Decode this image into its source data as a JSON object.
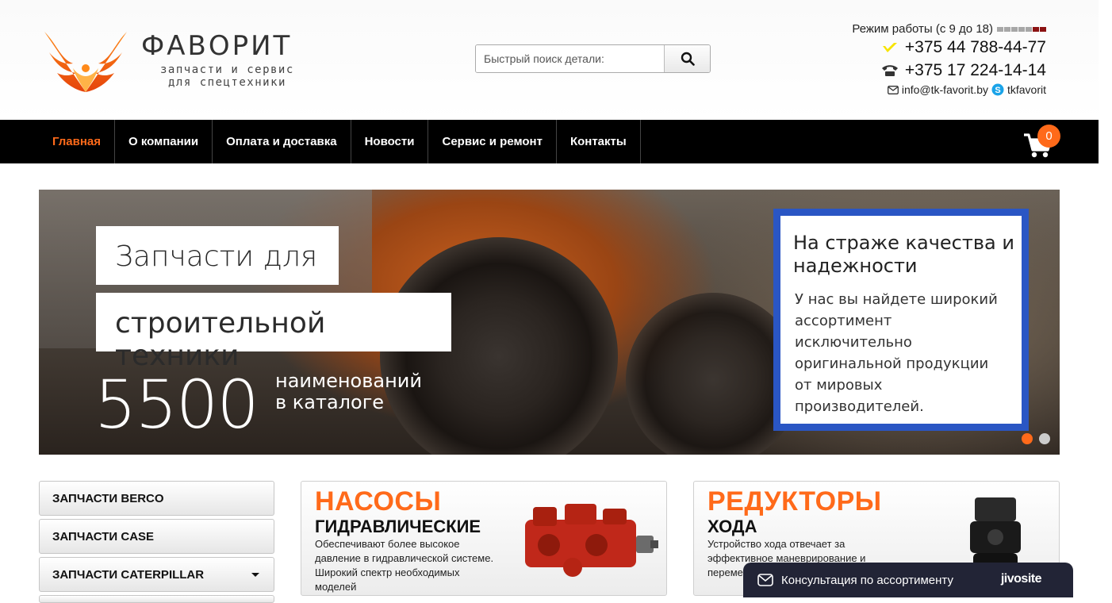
{
  "header": {
    "logo_name": "ФАВОРИТ",
    "logo_sub1": "запчасти и сервис",
    "logo_sub2": "для спецтехники",
    "search_placeholder": "Быстрый поиск детали:",
    "hours": "Режим работы (с 9 до 18)",
    "phone_mobile": "+375 44 788-44-77",
    "phone_city": "+375 17 224-14-14",
    "email": "info@tk-favorit.by",
    "skype": "tkfavorit"
  },
  "nav": {
    "items": [
      {
        "label": "Главная"
      },
      {
        "label": "О компании"
      },
      {
        "label": "Оплата и доставка"
      },
      {
        "label": "Новости"
      },
      {
        "label": "Сервис и ремонт"
      },
      {
        "label": "Контакты"
      }
    ],
    "cart_count": "0"
  },
  "banner": {
    "line1": "Запчасти для",
    "line2": "строительной техники",
    "number": "5500",
    "caption1": "наименований",
    "caption2": "в каталоге",
    "quality_title": "На страже качества и надежности",
    "quality_text": "У нас вы найдете широкий ассортимент исключительно оригинальной продукции от мировых производителей."
  },
  "sidebar": {
    "items": [
      {
        "label": "ЗАПЧАСТИ BERCO"
      },
      {
        "label": "ЗАПЧАСТИ CASE"
      },
      {
        "label": "ЗАПЧАСТИ CATERPILLAR"
      }
    ]
  },
  "cards": [
    {
      "title": "НАСОСЫ",
      "subtitle": "ГИДРАВЛИЧЕСКИЕ",
      "text": "Обеспечивают более высокое давление в гидравлической системе. Широкий спектр необходимых моделей"
    },
    {
      "title": "РЕДУКТОРЫ",
      "subtitle": "ХОДА",
      "text": "Устройство хода отвечает за эффективное маневрирование и переме строите"
    }
  ],
  "chat": {
    "label": "Консультация по ассортименту",
    "brand": "jivosite"
  },
  "colors": {
    "accent": "#ff6a1a",
    "nav_bg": "#000000",
    "banner_frame": "#2a56c4",
    "chat_bg": "#222436"
  }
}
